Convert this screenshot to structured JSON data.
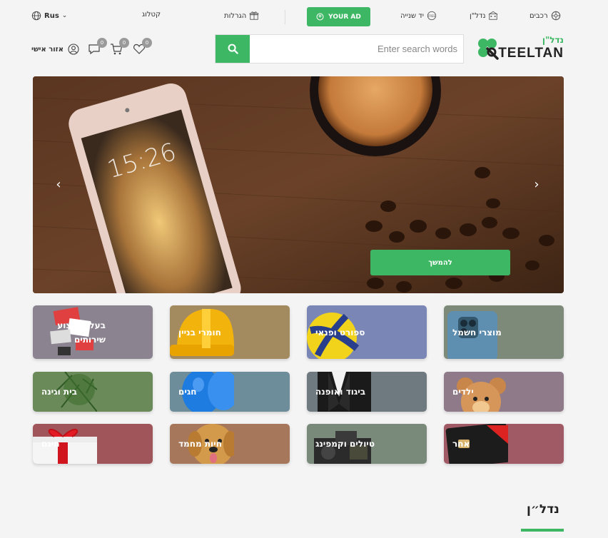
{
  "topnav": {
    "vehicles": "רכבים",
    "realestate": "נדל\"ן",
    "secondhand": "יד שנייה",
    "your_ad": "YOUR AD",
    "raffles": "הגרלות",
    "catalog": "קטלוג",
    "language": "Rus"
  },
  "header": {
    "search_placeholder": "Enter search words",
    "logo_he": "נדל\"ן",
    "logo_en": "TEELTAN",
    "favorites_count": "0",
    "cart_count": "0",
    "messages_count": "0",
    "account_label": "אזור אישי"
  },
  "hero": {
    "continue_label": "להמשך"
  },
  "categories": [
    {
      "label": "מוצרי חשמל",
      "color": "#7d8a7a"
    },
    {
      "label": "ספורט ופנאי",
      "color": "#7a86b5"
    },
    {
      "label": "חומרי בניין",
      "color": "#a38a5f"
    },
    {
      "label": "בעלי מקצוע שירותים",
      "color": "#8c8390"
    },
    {
      "label": "ילדים",
      "color": "#8e7a88"
    },
    {
      "label": "ביגוד ואופנה",
      "color": "#6f7a80"
    },
    {
      "label": "חגים",
      "color": "#6c8d99"
    },
    {
      "label": "בית וגינה",
      "color": "#6b8a5a"
    },
    {
      "label": "אחר",
      "color": "#a05a66"
    },
    {
      "label": "טיולים וקמפינג",
      "color": "#7a8a7a"
    },
    {
      "label": "חיות מחמד",
      "color": "#a6775a"
    },
    {
      "label": "חינם",
      "color": "#a0555a"
    }
  ],
  "section": {
    "title": "נדל״ן"
  },
  "colors": {
    "accent": "#3db764",
    "background": "#f4f4f4"
  }
}
